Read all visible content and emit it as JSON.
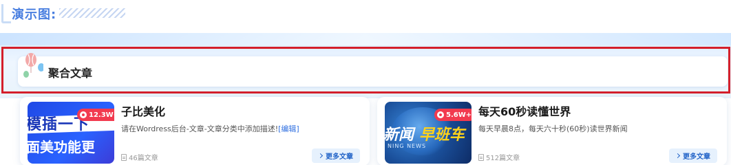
{
  "header": {
    "title": "演示图:"
  },
  "section": {
    "title": "聚合文章"
  },
  "cards": [
    {
      "title": "子比美化",
      "description": "请在Wordress后台-文章-文章分类中添加描述!",
      "edit_label": "[编辑]",
      "views": "12.3W+",
      "count": "46篇文章",
      "more_label": "更多文章",
      "thumb": {
        "line1": "模插一下",
        "line2": "面美功能更"
      }
    },
    {
      "title": "每天60秒读懂世界",
      "description": "每天早晨8点，每天六十秒(60秒)读世界新闻",
      "views": "5.6W+",
      "count": "512篇文章",
      "more_label": "更多文章",
      "thumb": {
        "line1": "新闻",
        "line2": "早班车",
        "line3": "NING NEWS"
      }
    }
  ],
  "colors": {
    "accent": "#4a7fe0",
    "highlight_frame": "#d41f2a",
    "badge": "#f23a4f"
  }
}
